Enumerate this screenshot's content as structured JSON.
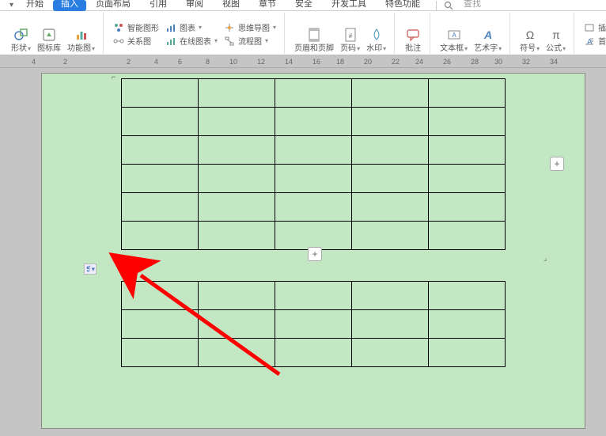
{
  "menu": {
    "dropdown_indicator": "▾",
    "tabs": [
      {
        "label": "开始",
        "active": false
      },
      {
        "label": "插入",
        "active": true
      },
      {
        "label": "页面布局",
        "active": false
      },
      {
        "label": "引用",
        "active": false
      },
      {
        "label": "审阅",
        "active": false
      },
      {
        "label": "视图",
        "active": false
      },
      {
        "label": "章节",
        "active": false
      },
      {
        "label": "安全",
        "active": false
      },
      {
        "label": "开发工具",
        "active": false
      },
      {
        "label": "特色功能",
        "active": false
      }
    ],
    "search_placeholder": "查找"
  },
  "ribbon": {
    "shapes": "形状",
    "icon_lib": "图标库",
    "func_chart": "功能图",
    "smart_art": "智能图形",
    "chart": "图表",
    "relation": "关系图",
    "online_chart": "在线图表",
    "mindmap": "思维导图",
    "flowchart": "流程图",
    "header_footer": "页眉和页脚",
    "page_number": "页码",
    "watermark": "水印",
    "comment": "批注",
    "textbox": "文本框",
    "wordart": "艺术字",
    "symbol": "符号",
    "equation": "公式",
    "insert_attach": "插入附件",
    "dropcap": "首字下"
  },
  "ruler_ticks": [
    "4",
    "2",
    "",
    "2",
    "4",
    "6",
    "8",
    "10",
    "12",
    "14",
    "16",
    "18",
    "20",
    "22",
    "24",
    "26",
    "28",
    "30",
    "32",
    "34"
  ],
  "handles": {
    "plus": "+"
  },
  "paragraph_hint": "❡▾"
}
